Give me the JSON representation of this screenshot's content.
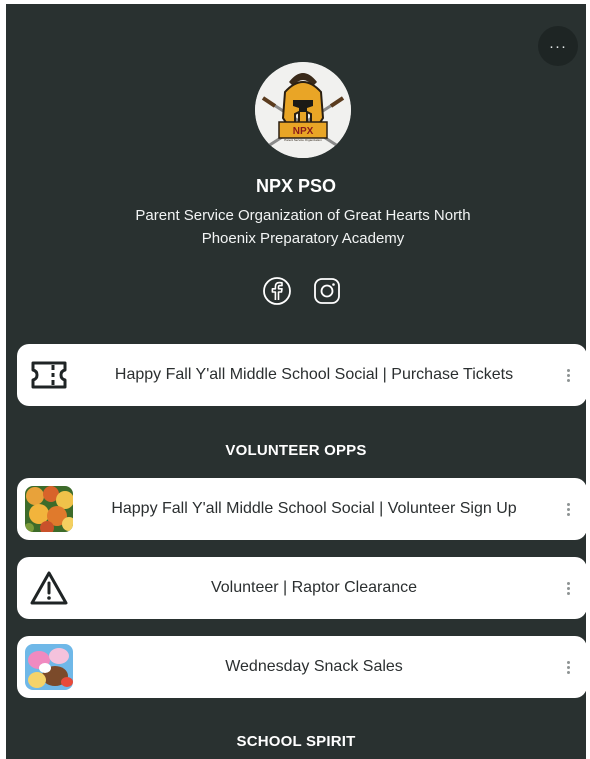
{
  "header": {
    "more_icon": "more-horizontal-icon",
    "more_label": "···"
  },
  "profile": {
    "avatar": "npx-spartan-helmet-logo",
    "logo_text": "NPX",
    "logo_subtext": "Parent Service Organization",
    "title": "NPX PSO",
    "bio": "Parent Service Organization of Great Hearts North Phoenix Preparatory Academy",
    "socials": [
      {
        "icon": "facebook-icon"
      },
      {
        "icon": "instagram-icon"
      }
    ]
  },
  "links": [
    {
      "label": "Happy Fall Y'all Middle School Social | Purchase Tickets",
      "thumb": "ticket-icon"
    }
  ],
  "sections": [
    {
      "heading": "VOLUNTEER OPPS",
      "links": [
        {
          "label": "Happy Fall Y'all Middle School Social | Volunteer Sign Up",
          "thumb": "autumn-flowers-photo"
        },
        {
          "label": "Volunteer | Raptor Clearance",
          "thumb": "warning-triangle-icon"
        },
        {
          "label": "Wednesday Snack Sales",
          "thumb": "snacks-photo"
        }
      ]
    },
    {
      "heading": "SCHOOL SPIRIT",
      "links": []
    }
  ],
  "colors": {
    "background": "#293130",
    "card": "#ffffff",
    "card_text": "#2b2f30",
    "accent_gold": "#e9a526"
  }
}
